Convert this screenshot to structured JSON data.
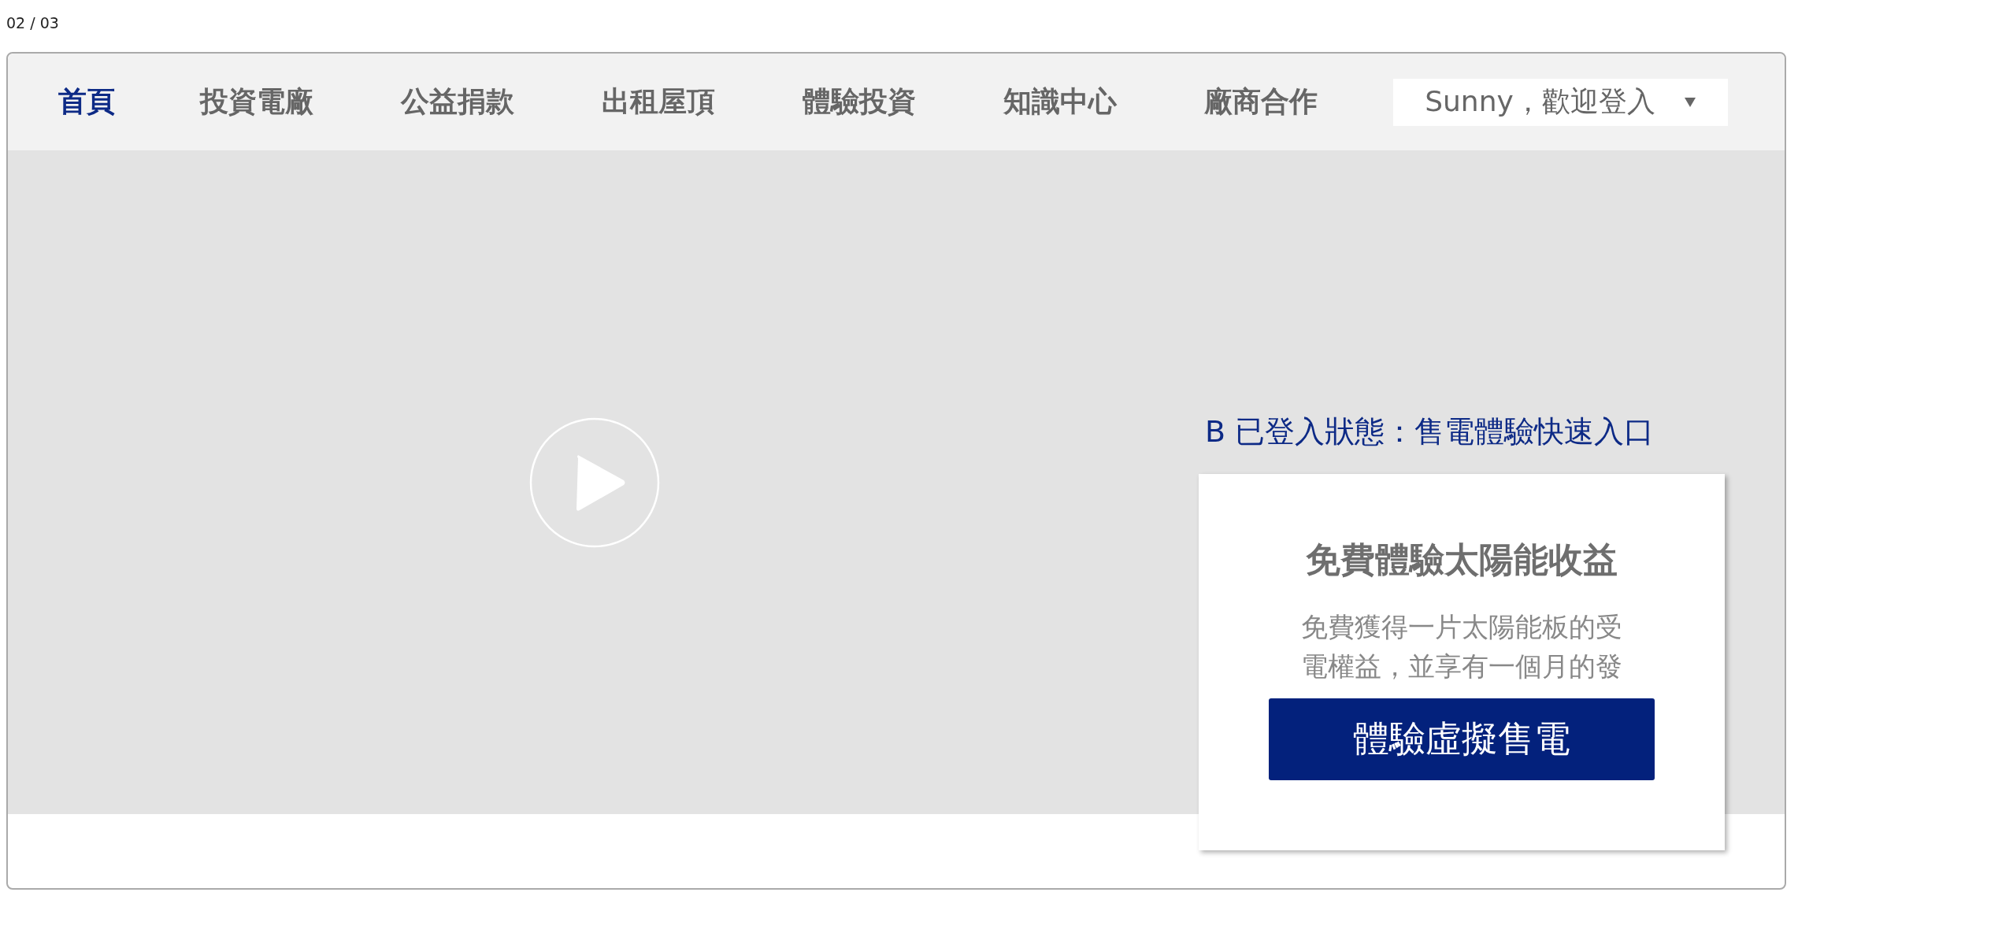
{
  "page_counter": "02 / 03",
  "nav": {
    "items": [
      {
        "label": "首頁",
        "selected": true
      },
      {
        "label": "投資電廠",
        "selected": false
      },
      {
        "label": "公益捐款",
        "selected": false
      },
      {
        "label": "出租屋頂",
        "selected": false
      },
      {
        "label": "體驗投資",
        "selected": false
      },
      {
        "label": "知識中心",
        "selected": false
      },
      {
        "label": "廠商合作",
        "selected": false
      }
    ],
    "user_menu": {
      "label": "Sunny，歡迎登入"
    }
  },
  "hero": {
    "video": {
      "kind": "video"
    },
    "annotation": "B 已登入狀態：售電體驗快速入口",
    "card": {
      "title": "免費體驗太陽能收益",
      "body": [
        "免費獲得一片太陽能板的受",
        "電權益，並享有一個月的發"
      ],
      "button": "體驗虛擬售電"
    }
  }
}
